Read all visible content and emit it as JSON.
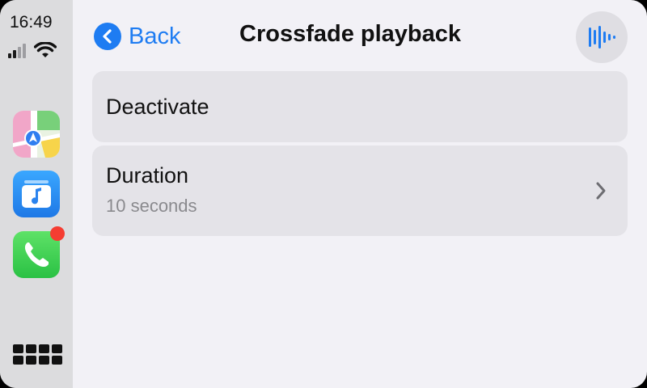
{
  "status_bar": {
    "time": "16:49",
    "signal_bars_active": 2,
    "signal_bars_total": 4,
    "wifi_icon": "wifi-icon"
  },
  "dock": {
    "apps": [
      {
        "name": "Maps",
        "icon": "maps-icon"
      },
      {
        "name": "Music",
        "icon": "music-icon"
      },
      {
        "name": "Phone",
        "icon": "phone-icon",
        "has_badge": true
      }
    ],
    "app_library_icon": "app-grid-icon"
  },
  "header": {
    "back_label": "Back",
    "title": "Crossfade playback",
    "voice_icon": "siri-waveform-icon"
  },
  "list": {
    "deactivate_label": "Deactivate",
    "duration_label": "Duration",
    "duration_value": "10 seconds"
  },
  "colors": {
    "accent": "#1e7cf2",
    "background": "#f2f1f6",
    "sidebar": "#dcdcde",
    "row": "#e4e3e8",
    "badge": "#f53d32"
  }
}
